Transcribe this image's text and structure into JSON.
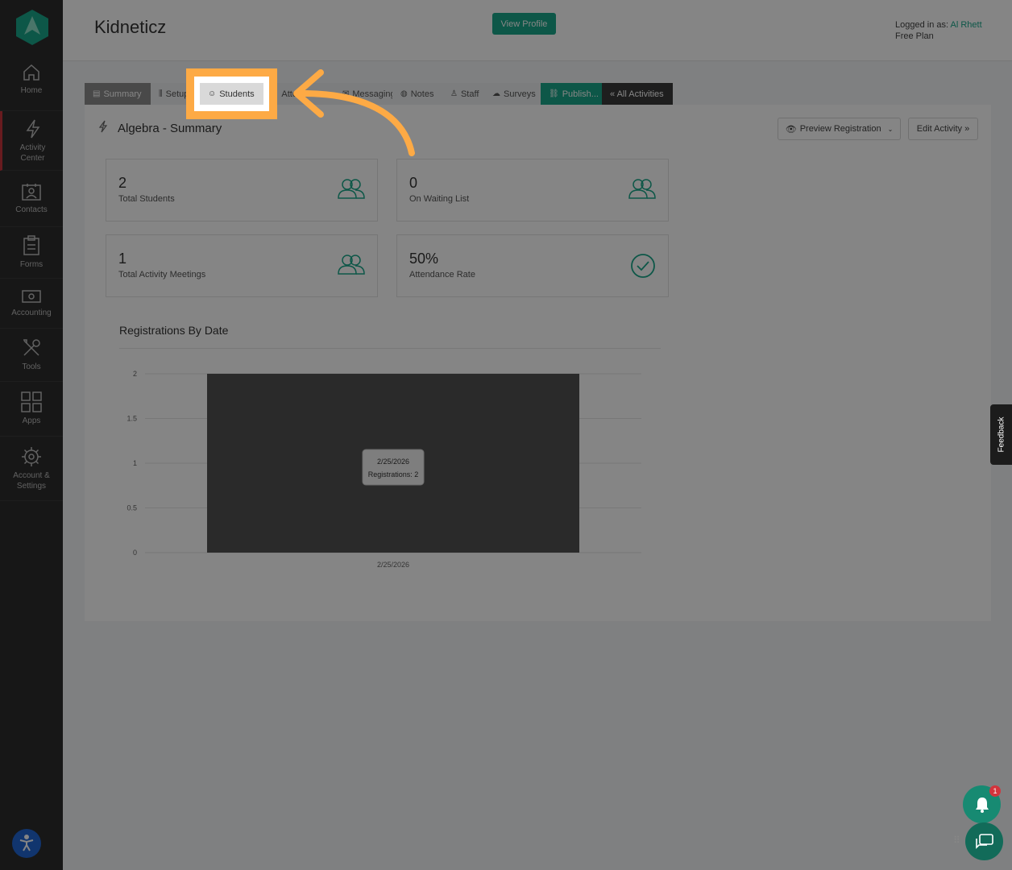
{
  "sidebar": {
    "items": [
      {
        "label": "Home",
        "icon": "home-icon"
      },
      {
        "label": "Activity Center",
        "icon": "bolt-icon"
      },
      {
        "label": "Contacts",
        "icon": "contacts-icon"
      },
      {
        "label": "Forms",
        "icon": "forms-icon"
      },
      {
        "label": "Accounting",
        "icon": "accounting-icon"
      },
      {
        "label": "Tools",
        "icon": "tools-icon"
      },
      {
        "label": "Apps",
        "icon": "apps-icon"
      },
      {
        "label": "Account & Settings",
        "icon": "gear-icon"
      }
    ]
  },
  "header": {
    "brand": "Kidneticz",
    "view_profile": "View Profile",
    "logged_in_prefix": "Logged in as:",
    "user": "Al Rhett",
    "plan": "Free Plan"
  },
  "tabs": [
    {
      "label": "Summary"
    },
    {
      "label": "Setup"
    },
    {
      "label": "Students"
    },
    {
      "label": "Attendance"
    },
    {
      "label": "Messaging"
    },
    {
      "label": "Notes"
    },
    {
      "label": "Staff"
    },
    {
      "label": "Surveys"
    },
    {
      "label": "Publish..."
    },
    {
      "label": "« All Activities"
    }
  ],
  "main": {
    "title": "Algebra - Summary",
    "preview_registration": "Preview Registration",
    "edit_activity": "Edit Activity »",
    "stats": [
      {
        "value": "2",
        "label": "Total Students"
      },
      {
        "value": "0",
        "label": "On Waiting List"
      },
      {
        "value": "1",
        "label": "Total Activity Meetings"
      },
      {
        "value": "50%",
        "label": "Attendance Rate"
      }
    ],
    "chart_title": "Registrations By Date"
  },
  "chart_data": {
    "type": "bar",
    "title": "Registrations By Date",
    "categories": [
      "2/25/2026"
    ],
    "values": [
      2
    ],
    "ylim": [
      0,
      2
    ],
    "yticks": [
      "0",
      "0.5",
      "1",
      "1.5",
      "2"
    ],
    "tooltip": {
      "date": "2/25/2026",
      "text": "Registrations: 2"
    },
    "bar_color": "#525252"
  },
  "widgets": {
    "feedback": "Feedback",
    "notification_count": "1"
  },
  "colors": {
    "accent": "#1aa88a",
    "highlight": "#fdaa45",
    "sidebar": "#2c2c2c"
  }
}
